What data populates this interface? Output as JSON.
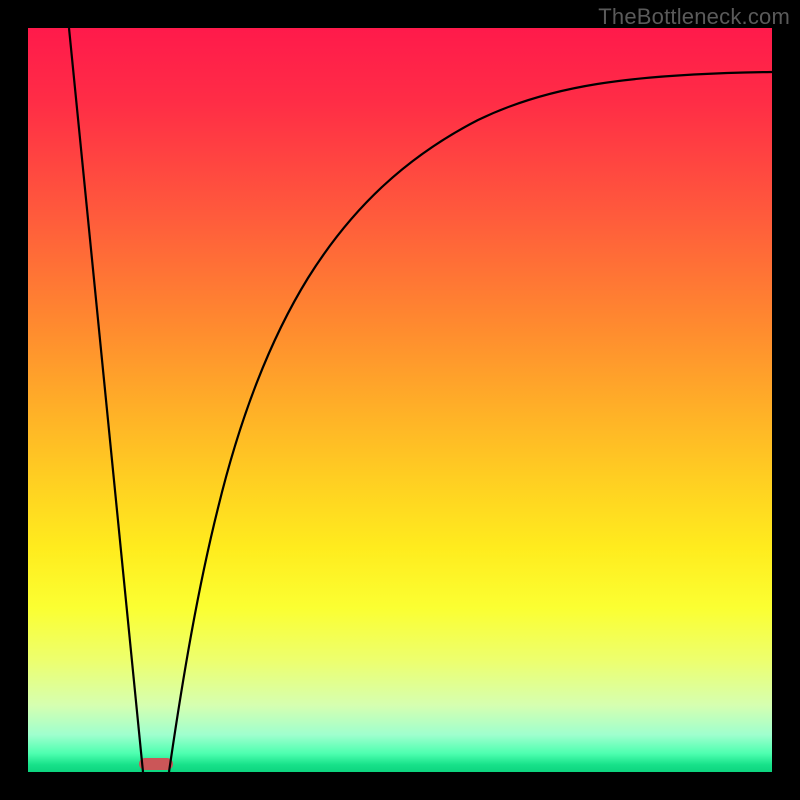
{
  "watermark": "TheBottleneck.com",
  "chart_data": {
    "type": "line",
    "title": "",
    "xlabel": "",
    "ylabel": "",
    "xlim": [
      0,
      100
    ],
    "ylim": [
      0,
      100
    ],
    "grid": false,
    "series": [
      {
        "name": "left-v-segment",
        "x": [
          5.5,
          15.5
        ],
        "y": [
          100,
          0
        ]
      },
      {
        "name": "right-curve",
        "x": [
          19,
          22,
          25,
          28,
          32,
          37,
          43,
          50,
          58,
          67,
          77,
          88,
          100
        ],
        "y": [
          0,
          13,
          25,
          35,
          46,
          57,
          66,
          74,
          80,
          85,
          89,
          92,
          94
        ]
      }
    ],
    "marker": {
      "x_center": 17.3,
      "y_center": 0.8,
      "width_pct": 4.6,
      "height_pct": 1.6,
      "color": "#cb5658"
    },
    "gradient_stops": [
      {
        "pct": 0,
        "color": "#ff1a4b"
      },
      {
        "pct": 10,
        "color": "#ff2d46"
      },
      {
        "pct": 25,
        "color": "#ff5a3c"
      },
      {
        "pct": 40,
        "color": "#ff8a2f"
      },
      {
        "pct": 52,
        "color": "#ffb227"
      },
      {
        "pct": 62,
        "color": "#ffd321"
      },
      {
        "pct": 70,
        "color": "#ffec1e"
      },
      {
        "pct": 78,
        "color": "#fbff32"
      },
      {
        "pct": 85,
        "color": "#edff6e"
      },
      {
        "pct": 91,
        "color": "#d6ffb0"
      },
      {
        "pct": 95,
        "color": "#9fffce"
      },
      {
        "pct": 97.5,
        "color": "#4effb0"
      },
      {
        "pct": 99,
        "color": "#18e28a"
      },
      {
        "pct": 100,
        "color": "#0cd47f"
      }
    ]
  }
}
